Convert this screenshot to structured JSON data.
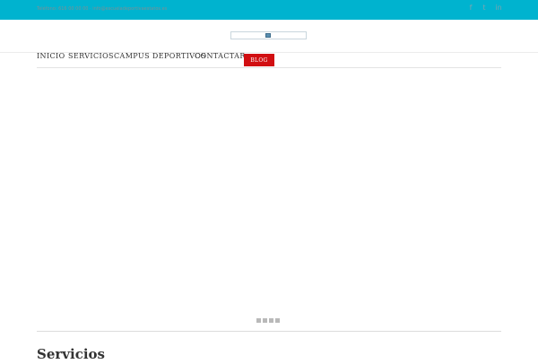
{
  "topbar": {
    "contact": "Teléfono: 616 00 00 00 · info@escueladeportivaestatos.es",
    "social": {
      "facebook": "f",
      "twitter": "t",
      "linkedin": "in"
    },
    "background": "#00b3cf"
  },
  "nav": {
    "items": [
      {
        "label": "INICIO"
      },
      {
        "label": "SERVICIOS"
      },
      {
        "label": "CAMPUS DEPORTIVOS"
      },
      {
        "label": "CONTACTAR"
      }
    ],
    "blog_label": "BLOG",
    "blog_color": "#d10f12"
  },
  "slider": {
    "slide_count": 4
  },
  "section": {
    "title": "Servicios"
  }
}
